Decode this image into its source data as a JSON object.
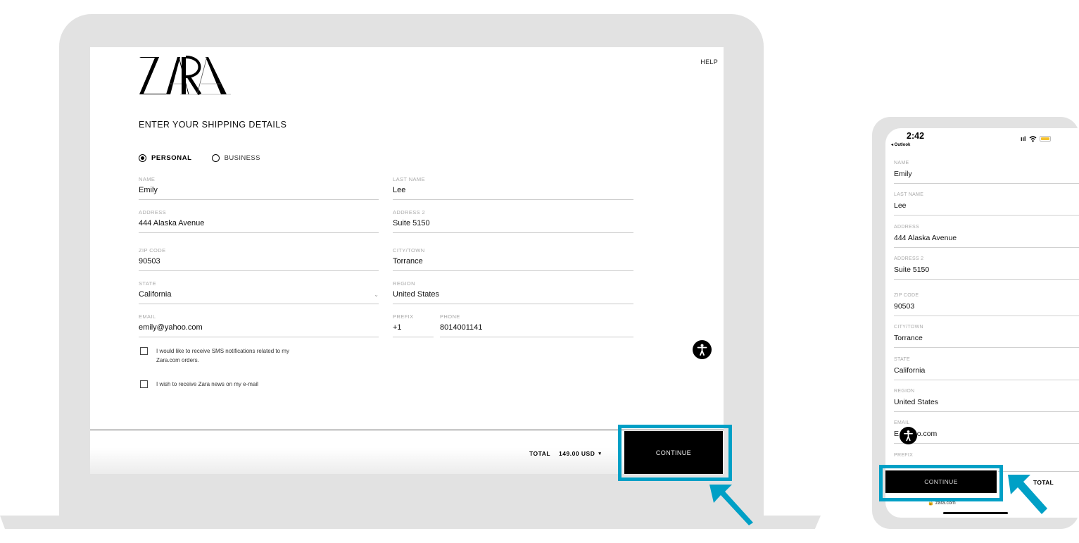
{
  "desktop": {
    "brand": "ZARA",
    "help_label": "HELP",
    "page_title": "ENTER YOUR SHIPPING DETAILS",
    "customer_type": {
      "options": [
        {
          "label": "PERSONAL",
          "selected": true
        },
        {
          "label": "BUSINESS",
          "selected": false
        }
      ]
    },
    "fields": {
      "name": {
        "label": "NAME",
        "value": "Emily"
      },
      "last_name": {
        "label": "LAST NAME",
        "value": "Lee"
      },
      "address": {
        "label": "ADDRESS",
        "value": "444 Alaska Avenue"
      },
      "address2": {
        "label": "ADDRESS 2",
        "value": "Suite 5150"
      },
      "zip": {
        "label": "ZIP CODE",
        "value": "90503"
      },
      "city": {
        "label": "CITY/TOWN",
        "value": "Torrance"
      },
      "state": {
        "label": "STATE",
        "value": "California"
      },
      "region": {
        "label": "REGION",
        "value": "United States"
      },
      "email": {
        "label": "EMAIL",
        "value": "emily@yahoo.com"
      },
      "prefix": {
        "label": "PREFIX",
        "value": "+1"
      },
      "phone": {
        "label": "PHONE",
        "value": "8014001141"
      }
    },
    "checkboxes": [
      {
        "label_line1": "I would like to receive SMS notifications related to my",
        "label_line2": "Zara.com orders.",
        "checked": false
      },
      {
        "label_line1": "I wish to receive Zara news on my e-mail",
        "checked": false
      }
    ],
    "footer": {
      "total_label": "TOTAL",
      "total_amount": "149.00 USD",
      "caret": "▾",
      "continue_label": "CONTINUE"
    }
  },
  "mobile": {
    "status": {
      "time": "2:42",
      "back_label": "◂ Outlook"
    },
    "fields": [
      {
        "label": "NAME",
        "value": "Emily"
      },
      {
        "label": "LAST NAME",
        "value": "Lee"
      },
      {
        "label": "ADDRESS",
        "value": "444 Alaska Avenue"
      },
      {
        "label": "ADDRESS 2",
        "value": "Suite 5150"
      },
      {
        "label": "ZIP CODE",
        "value": "90503"
      },
      {
        "label": "CITY/TOWN",
        "value": "Torrance"
      },
      {
        "label": "STATE",
        "value": "California"
      },
      {
        "label": "REGION",
        "value": "United States"
      },
      {
        "label": "EMAIL",
        "value": "E    yahoo.com"
      }
    ],
    "prefix_label": "PREFIX",
    "continue_label": "CONTINUE",
    "total_label": "TOTAL",
    "url": "🔒 zara.com"
  },
  "annotation": {
    "highlight_color": "#00a0c6"
  }
}
